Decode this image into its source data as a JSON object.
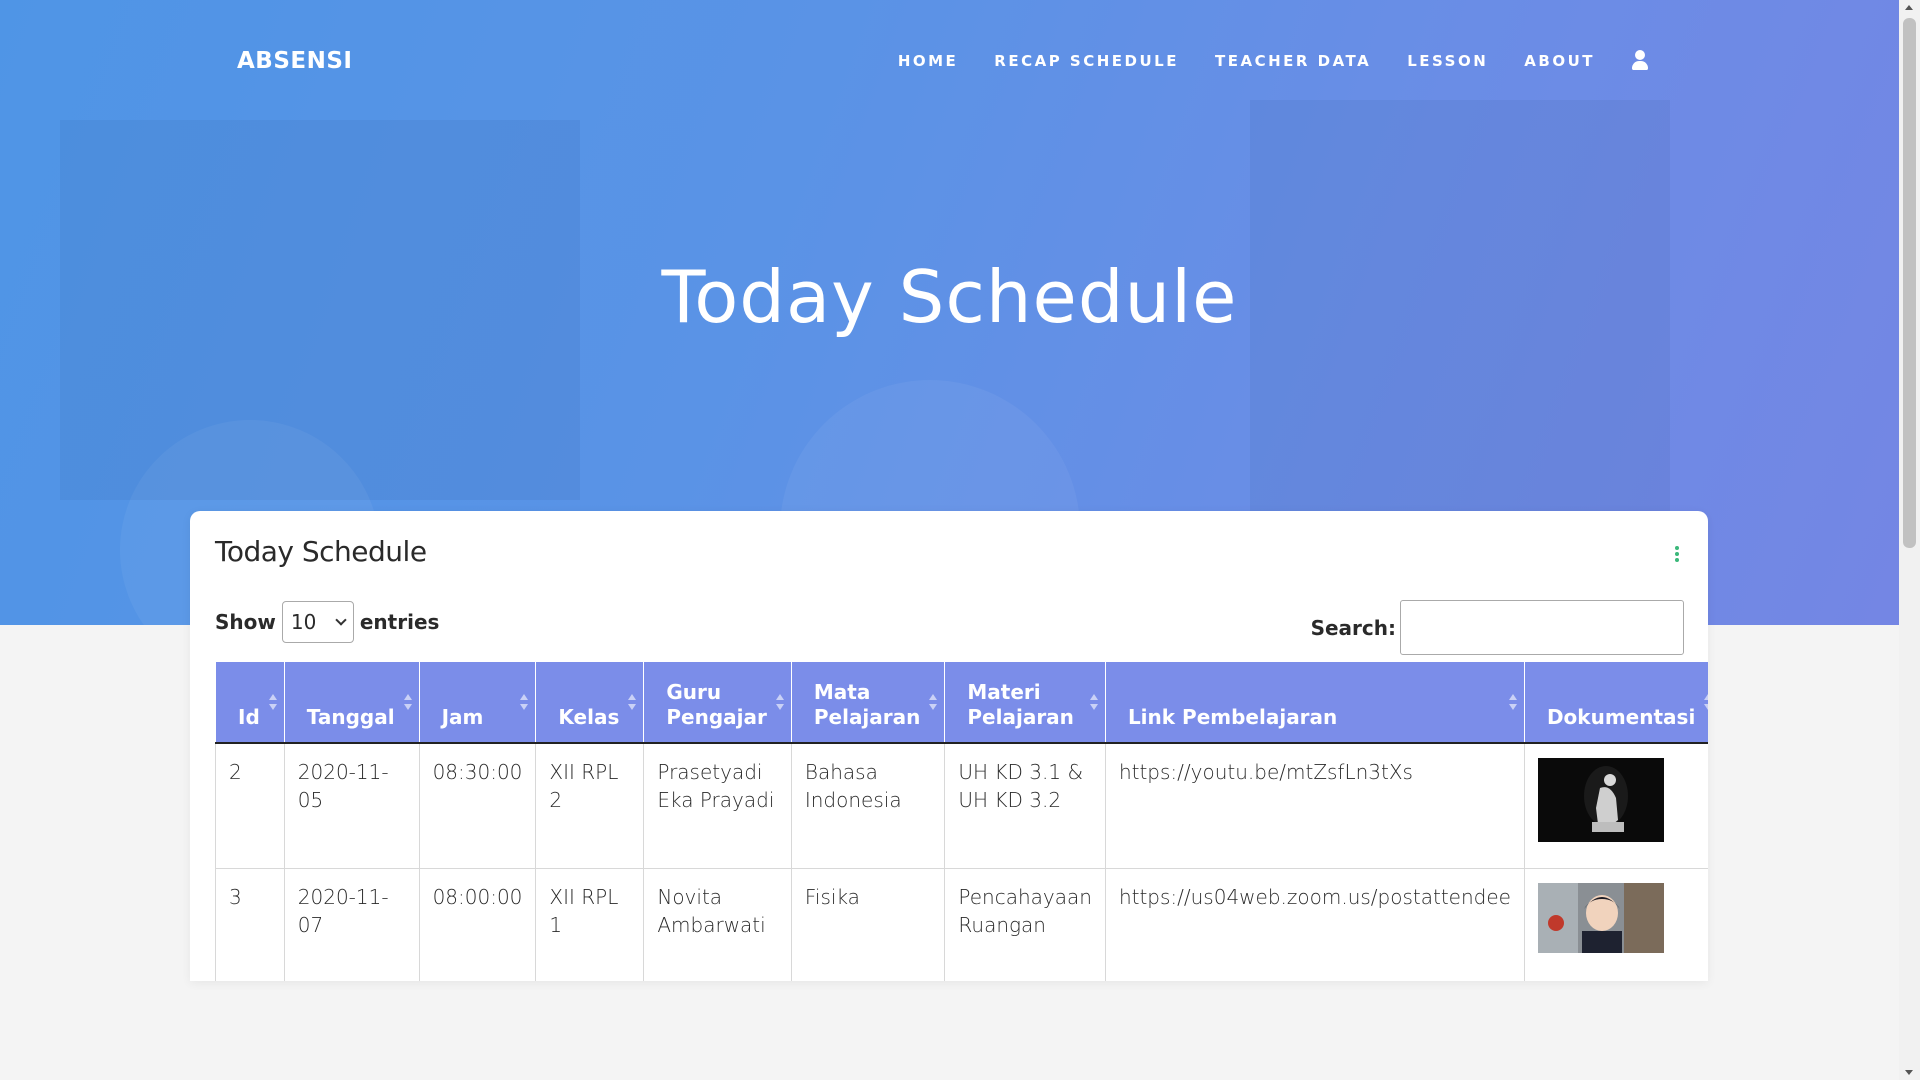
{
  "brand": "ABSENSI",
  "nav": {
    "items": [
      {
        "label": "HOME"
      },
      {
        "label": "RECAP SCHEDULE"
      },
      {
        "label": "TEACHER DATA"
      },
      {
        "label": "LESSON"
      },
      {
        "label": "ABOUT"
      }
    ],
    "user_icon": "user-icon"
  },
  "hero": {
    "title": "Today Schedule"
  },
  "card": {
    "title": "Today Schedule",
    "show_label": "Show",
    "entries_value": "10",
    "entries_label": "entries",
    "search_label": "Search:",
    "search_value": ""
  },
  "table": {
    "columns": [
      {
        "label_1": "",
        "label_2": "Id"
      },
      {
        "label_1": "",
        "label_2": "Tanggal"
      },
      {
        "label_1": "",
        "label_2": "Jam"
      },
      {
        "label_1": "",
        "label_2": "Kelas"
      },
      {
        "label_1": "Guru",
        "label_2": "Pengajar"
      },
      {
        "label_1": "Mata",
        "label_2": "Pelajaran"
      },
      {
        "label_1": "Materi",
        "label_2": "Pelajaran"
      },
      {
        "label_1": "",
        "label_2": "Link Pembelajaran"
      },
      {
        "label_1": "",
        "label_2": "Dokumentasi"
      }
    ],
    "rows": [
      {
        "id": "2",
        "tanggal": "2020-11-05",
        "jam": "08:30:00",
        "kelas": "XII RPL 2",
        "guru": "Prasetyadi Eka Prayadi",
        "mapel": "Bahasa Indonesia",
        "materi": "UH KD 3.1 & UH KD 3.2",
        "link": "https://youtu.be/mtZsfLn3tXs"
      },
      {
        "id": "3",
        "tanggal": "2020-11-07",
        "jam": "08:00:00",
        "kelas": "XII RPL 1",
        "guru": "Novita Ambarwati",
        "mapel": "Fisika",
        "materi": "Pencahayaan Ruangan",
        "link": "https://us04web.zoom.us/postattendee"
      }
    ]
  },
  "colors": {
    "hero_start": "#4f95e6",
    "hero_end": "#7486e4",
    "table_header": "#7b8de9",
    "accent_dots": "#3bb87a"
  }
}
